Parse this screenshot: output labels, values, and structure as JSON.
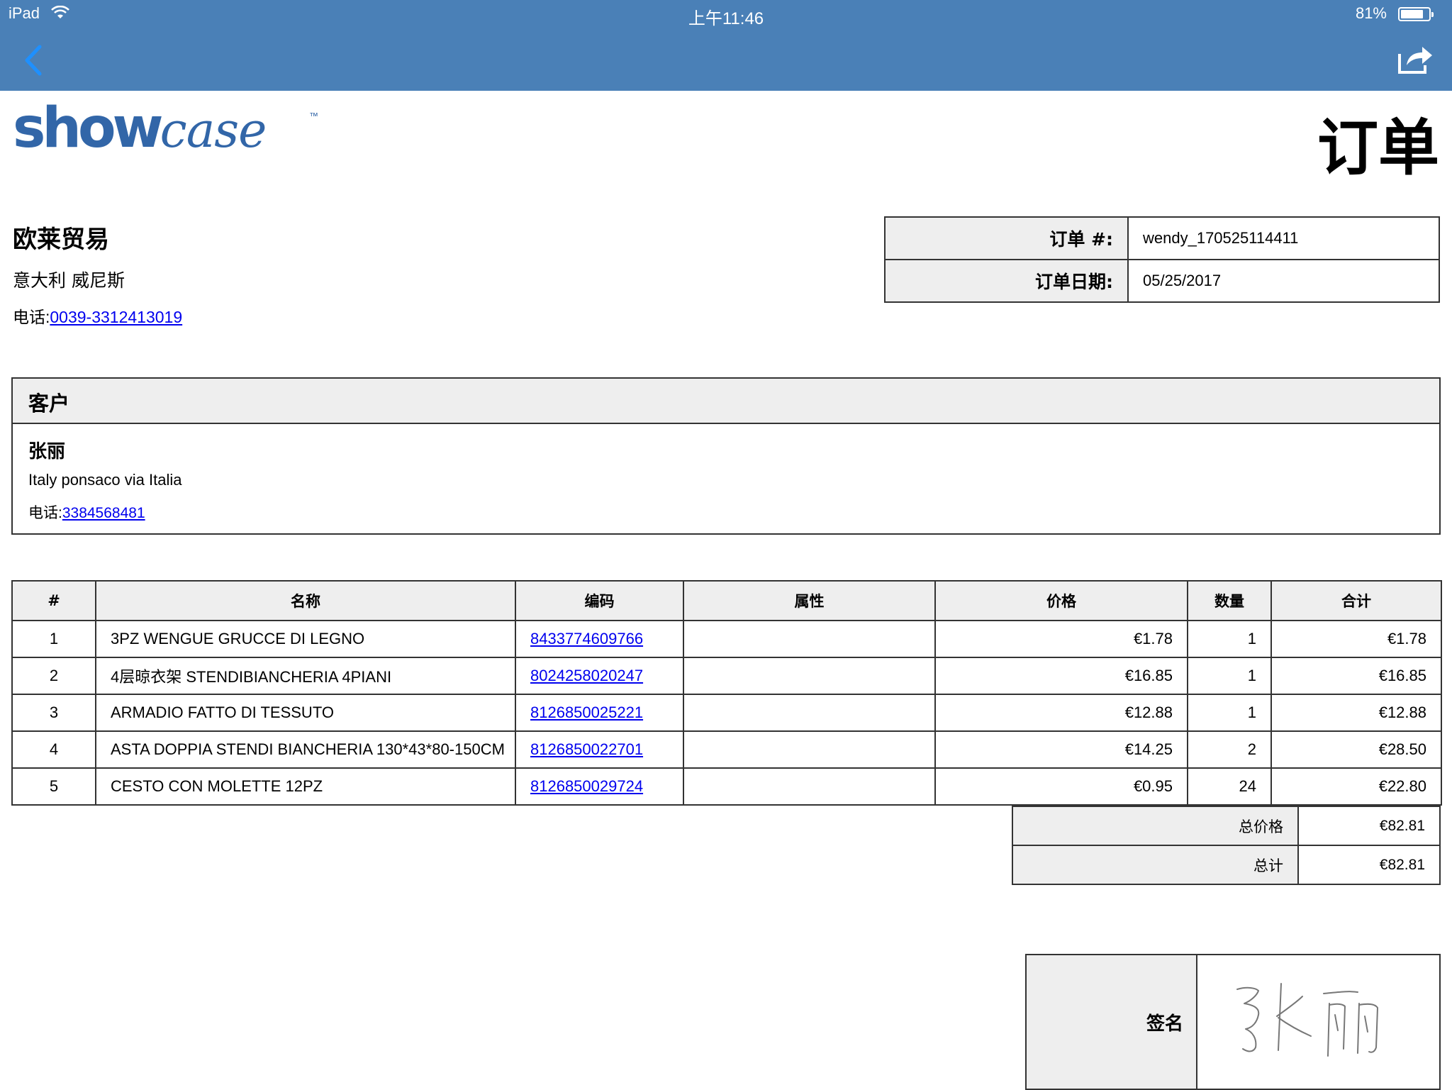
{
  "status_bar": {
    "device": "iPad",
    "time": "上午11:46",
    "battery_percent": "81%",
    "battery_level": 0.81
  },
  "nav": {
    "back_icon": "chevron-left-icon",
    "share_icon": "share-icon"
  },
  "header": {
    "logo_main": "show",
    "logo_script": "case",
    "logo_tm": "™",
    "doc_title": "订单"
  },
  "company": {
    "name": "欧莱贸易",
    "address": "意大利 威尼斯",
    "phone_label": "电话:",
    "phone": "0039-3312413019"
  },
  "order": {
    "number_label": "订单 #:",
    "number": "wendy_170525114411",
    "date_label": "订单日期:",
    "date": "05/25/2017"
  },
  "customer": {
    "header": "客户",
    "name": "张丽",
    "address": "Italy ponsaco via Italia",
    "phone_label": "电话:",
    "phone": "3384568481"
  },
  "items": {
    "columns": [
      "#",
      "名称",
      "编码",
      "属性",
      "价格",
      "数量",
      "合计"
    ],
    "rows": [
      {
        "num": "1",
        "name": "3PZ WENGUE GRUCCE DI LEGNO",
        "code": "8433774609766",
        "attr": "",
        "price": "€1.78",
        "qty": "1",
        "total": "€1.78"
      },
      {
        "num": "2",
        "name": "4层晾衣架 STENDIBIANCHERIA 4PIANI",
        "code": "8024258020247",
        "attr": "",
        "price": "€16.85",
        "qty": "1",
        "total": "€16.85"
      },
      {
        "num": "3",
        "name": "ARMADIO FATTO DI TESSUTO",
        "code": "8126850025221",
        "attr": "",
        "price": "€12.88",
        "qty": "1",
        "total": "€12.88"
      },
      {
        "num": "4",
        "name": "ASTA DOPPIA STENDI BIANCHERIA 130*43*80-150CM",
        "code": "8126850022701",
        "attr": "",
        "price": "€14.25",
        "qty": "2",
        "total": "€28.50"
      },
      {
        "num": "5",
        "name": "CESTO CON MOLETTE 12PZ",
        "code": "8126850029724",
        "attr": "",
        "price": "€0.95",
        "qty": "24",
        "total": "€22.80"
      }
    ]
  },
  "totals": {
    "subtotal_label": "总价格",
    "subtotal": "€82.81",
    "total_label": "总计",
    "total": "€82.81"
  },
  "signature": {
    "label": "签名",
    "signed_name": "张丽"
  },
  "colors": {
    "nav_bar": "#4a80b7",
    "brand_blue": "#3266a8",
    "link": "#0000ee",
    "header_cell": "#eeeeee",
    "back_button": "#1e90ff"
  }
}
